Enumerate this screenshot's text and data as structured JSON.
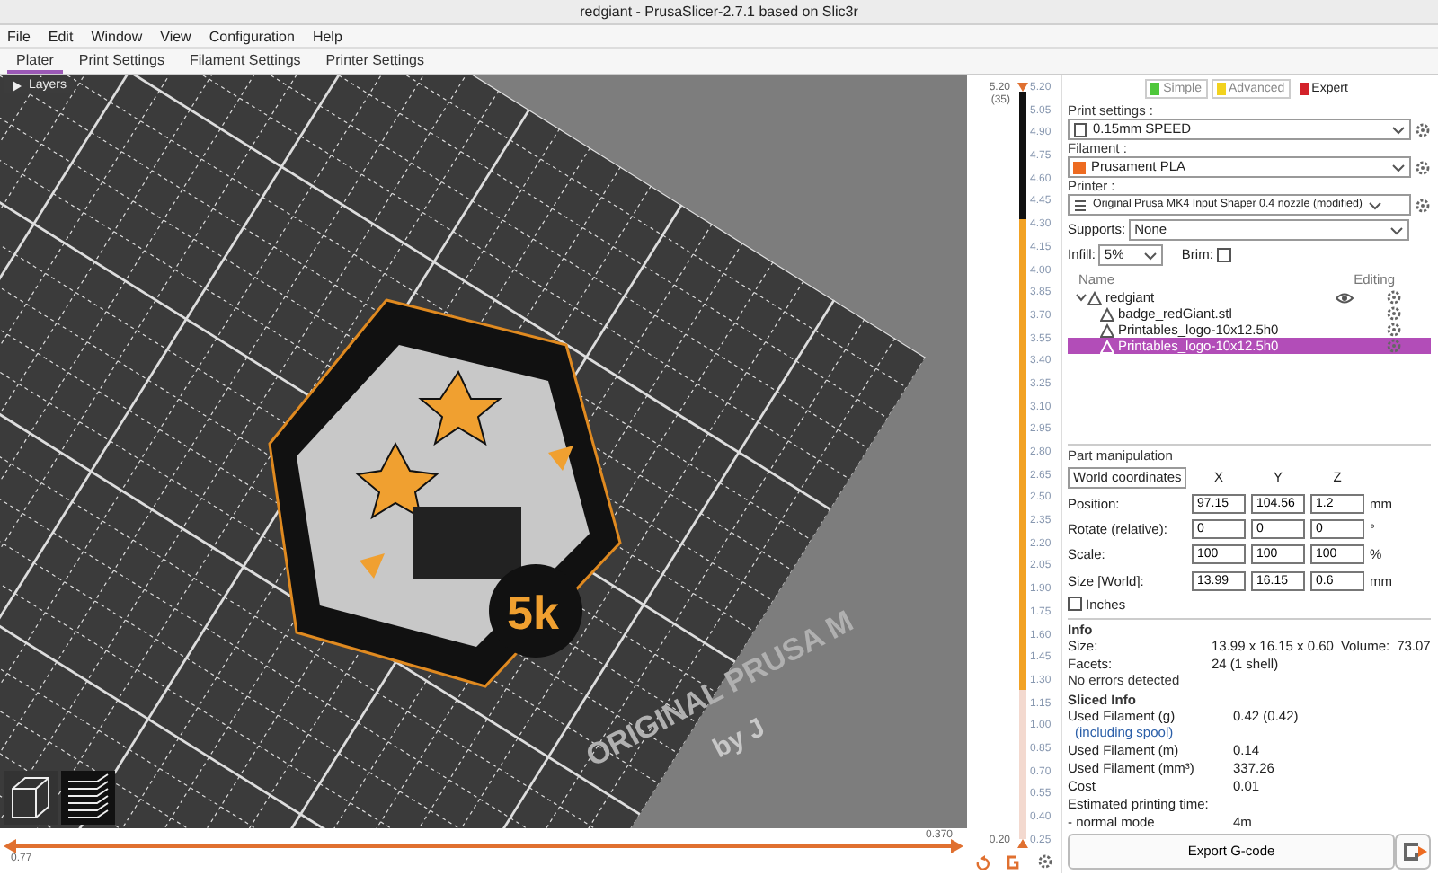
{
  "window": {
    "title": "redgiant - PrusaSlicer-2.7.1 based on Slic3r"
  },
  "menu": [
    "File",
    "Edit",
    "Window",
    "View",
    "Configuration",
    "Help"
  ],
  "tabs": [
    {
      "label": "Plater",
      "selected": true
    },
    {
      "label": "Print Settings",
      "selected": false
    },
    {
      "label": "Filament Settings",
      "selected": false
    },
    {
      "label": "Printer Settings",
      "selected": false
    }
  ],
  "view": {
    "layers_label": "Layers",
    "bed_logo": "ORIGINAL PRUSA M",
    "bed_logo_sub": "by J",
    "model_label": "5k"
  },
  "layer_slider": {
    "upper_value": "5.20",
    "upper_count": "(35)",
    "lower_value": "0.20",
    "tick_labels": [
      "5.20",
      "5.05",
      "4.90",
      "4.75",
      "4.60",
      "4.45",
      "4.30",
      "4.15",
      "4.00",
      "3.85",
      "3.70",
      "3.55",
      "3.40",
      "3.25",
      "3.10",
      "2.95",
      "2.80",
      "2.65",
      "2.50",
      "2.35",
      "2.20",
      "2.05",
      "1.90",
      "1.75",
      "1.60",
      "1.45",
      "1.30",
      "1.15",
      "1.00",
      "0.85",
      "0.70",
      "0.55",
      "0.40",
      "0.25"
    ],
    "bands": [
      {
        "color": "#f2a224",
        "level": 0.83
      },
      {
        "color": "#f3d9cf",
        "level": 0.2
      }
    ]
  },
  "move_slider": {
    "left_value": "0.77",
    "right_value": "0.370",
    "level": 1
  },
  "modes": [
    {
      "label": "Simple",
      "color": "#4ec73a",
      "selected": false
    },
    {
      "label": "Advanced",
      "color": "#f2d21e",
      "selected": false
    },
    {
      "label": "Expert",
      "color": "#d3222a",
      "selected": true
    }
  ],
  "print_settings": {
    "label": "Print settings :",
    "value": "0.15mm SPEED"
  },
  "filament": {
    "label": "Filament :",
    "value": "Prusament PLA",
    "color": "#ed6b21"
  },
  "printer": {
    "label": "Printer :",
    "value": "Original Prusa MK4 Input Shaper 0.4 nozzle (modified)"
  },
  "supports": {
    "label": "Supports:",
    "value": "None"
  },
  "infill": {
    "label": "Infill:",
    "value": "5%"
  },
  "brim": {
    "label": "Brim:",
    "checked": false
  },
  "object_list": {
    "columns": [
      "Name",
      "Editing"
    ],
    "items": [
      {
        "name": "redgiant",
        "expanded": true,
        "selected": false,
        "children": [
          {
            "name": "badge_redGiant.stl",
            "selected": false
          },
          {
            "name": "Printables_logo-10x12.5h0",
            "selected": false
          },
          {
            "name": "Printables_logo-10x12.5h0",
            "selected": true
          }
        ]
      }
    ]
  },
  "part_manipulation": {
    "title": "Part manipulation",
    "coordinates": "World coordinates",
    "axes": [
      "X",
      "Y",
      "Z"
    ],
    "rows": [
      {
        "label": "Position:",
        "values": [
          "97.15",
          "104.56",
          "1.2"
        ],
        "unit": "mm"
      },
      {
        "label": "Rotate (relative):",
        "values": [
          "0",
          "0",
          "0"
        ],
        "unit": "°"
      },
      {
        "label": "Scale:",
        "values": [
          "100",
          "100",
          "100"
        ],
        "unit": "%"
      },
      {
        "label": "Size [World]:",
        "values": [
          "13.99",
          "16.15",
          "0.6"
        ],
        "unit": "mm"
      }
    ],
    "inches": {
      "label": "Inches",
      "checked": false
    }
  },
  "info": {
    "title": "Info",
    "rows": [
      {
        "label": "Size:",
        "value": "13.99 x 16.15 x 0.60",
        "extra_label": "Volume:",
        "extra_value": "73.07"
      },
      {
        "label": "Facets:",
        "value": "24 (1 shell)"
      }
    ],
    "status": "No errors detected"
  },
  "sliced_info": {
    "title": "Sliced Info",
    "rows": [
      {
        "label": "Used Filament (g)",
        "sub": "(including spool)",
        "value": "0.42 (0.42)"
      },
      {
        "label": "Used Filament (m)",
        "value": "0.14"
      },
      {
        "label": "Used Filament (mm³)",
        "value": "337.26"
      },
      {
        "label": "Cost",
        "value": "0.01"
      },
      {
        "label": "Estimated printing time:"
      },
      {
        "label": "- normal mode",
        "value": "4m"
      }
    ]
  },
  "export_button": "Export G-code"
}
